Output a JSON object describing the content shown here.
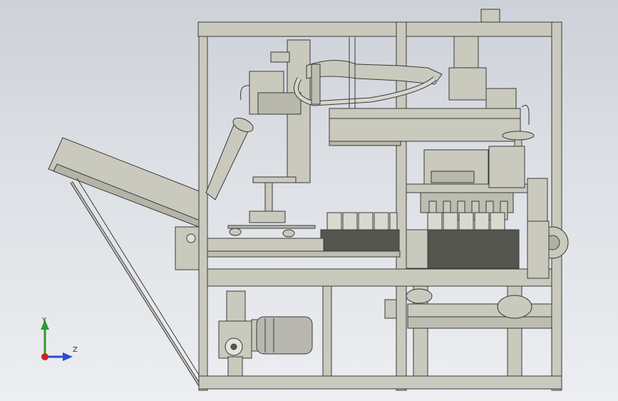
{
  "viewport": {
    "background_top": "#cdd1d8",
    "background_bottom": "#eceef1"
  },
  "model": {
    "fill_color": "#c9c9bd",
    "edge_color": "#3a3a3a",
    "motor_color": "#b8b8b0"
  },
  "triad": {
    "y_label": "Y",
    "z_label": "Z",
    "y_color": "#2e9a2e",
    "z_color": "#2a4ad0",
    "origin_color": "#d02020"
  }
}
